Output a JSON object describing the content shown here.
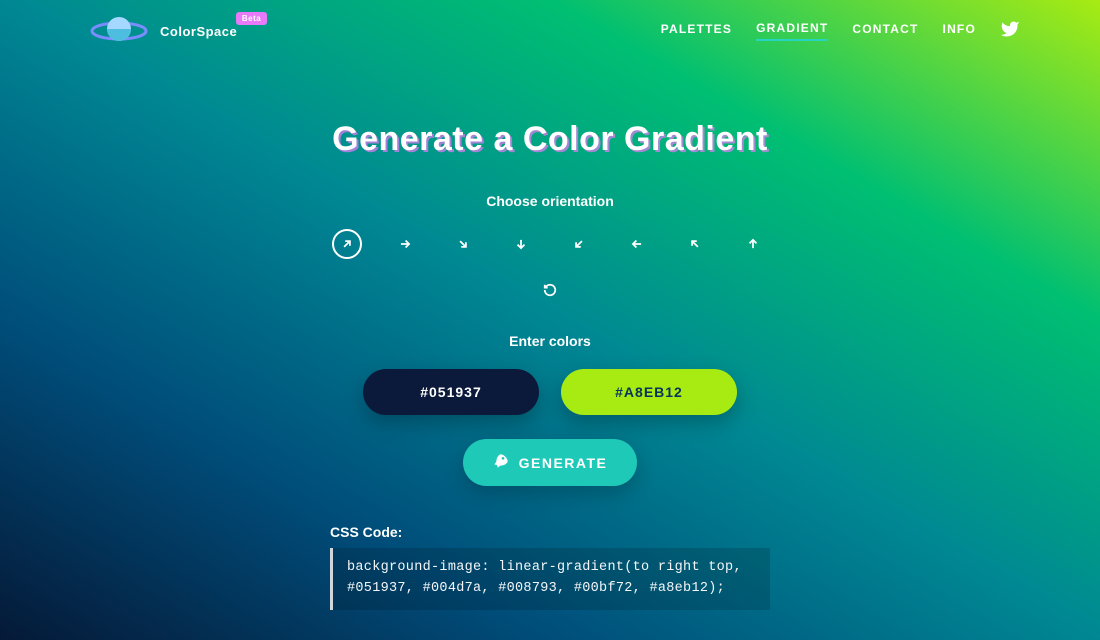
{
  "brand": {
    "name": "ColorSpace",
    "badge": "Beta"
  },
  "nav": {
    "items": [
      {
        "label": "PALETTES",
        "active": false
      },
      {
        "label": "GRADIENT",
        "active": true
      },
      {
        "label": "CONTACT",
        "active": false
      },
      {
        "label": "INFO",
        "active": false
      }
    ]
  },
  "main": {
    "title": "Generate a Color Gradient",
    "orientation_label": "Choose orientation",
    "colors_label": "Enter colors",
    "color1": "#051937",
    "color2": "#A8EB12",
    "generate_label": "GENERATE"
  },
  "orientations": [
    {
      "name": "top-right",
      "selected": true
    },
    {
      "name": "right",
      "selected": false
    },
    {
      "name": "bottom-right",
      "selected": false
    },
    {
      "name": "bottom",
      "selected": false
    },
    {
      "name": "bottom-left",
      "selected": false
    },
    {
      "name": "left",
      "selected": false
    },
    {
      "name": "top-left",
      "selected": false
    },
    {
      "name": "top",
      "selected": false
    }
  ],
  "css_output": {
    "label": "CSS Code:",
    "code": "background-image: linear-gradient(to right top, #051937, #004d7a, #008793, #00bf72, #a8eb12);"
  },
  "gradient_stops": [
    "#051937",
    "#004d7a",
    "#008793",
    "#00bf72",
    "#a8eb12"
  ]
}
